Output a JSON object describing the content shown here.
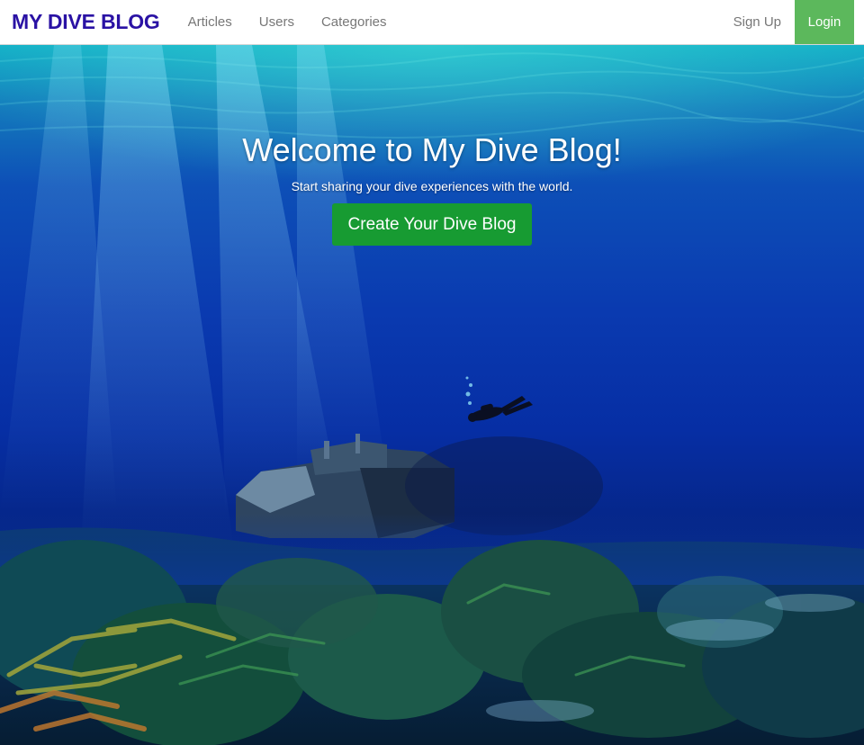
{
  "navbar": {
    "brand": "MY DIVE BLOG",
    "links": [
      {
        "label": "Articles"
      },
      {
        "label": "Users"
      },
      {
        "label": "Categories"
      }
    ],
    "signup_label": "Sign Up",
    "login_label": "Login"
  },
  "hero": {
    "title": "Welcome to My Dive Blog!",
    "subtitle": "Start sharing your dive experiences with the world.",
    "cta_label": "Create Your Dive Blog",
    "background_image": "underwater-shipwreck-diver-coral-reef",
    "elements": [
      "shipwreck",
      "scuba-diver",
      "coral-reef"
    ]
  },
  "colors": {
    "brand": "#2a12a4",
    "nav_link": "#777777",
    "login_bg": "#5cb85c",
    "cta_bg": "#179b32",
    "ocean_top": "#11aec6",
    "ocean_deep": "#0a3ab0"
  }
}
